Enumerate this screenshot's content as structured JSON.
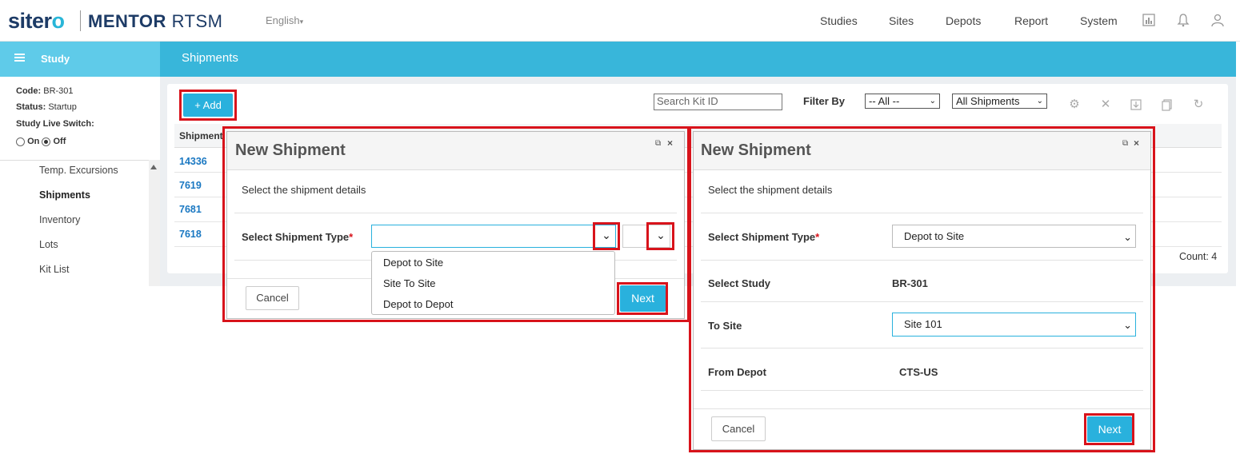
{
  "app": {
    "brand_a": "siter",
    "brand_o": "o",
    "brand_b": "MENTOR",
    "brand_c": "RTSM",
    "language": "English"
  },
  "nav": [
    "Studies",
    "Sites",
    "Depots",
    "Report",
    "System"
  ],
  "bar": {
    "study": "Study",
    "page_title": "Shipments"
  },
  "study_info": {
    "code_label": "Code:",
    "code": "BR-301",
    "status_label": "Status:",
    "status": "Startup",
    "live_label": "Study Live Switch:",
    "on": "On",
    "off": "Off"
  },
  "sidebar": {
    "items": [
      "Temp. Excursions",
      "Shipments",
      "Inventory",
      "Lots",
      "Kit List"
    ]
  },
  "toolbar": {
    "add": "+ Add",
    "search_placeholder": "Search Kit ID",
    "filter_by": "Filter By",
    "filter_all": "-- All --",
    "filter_ship": "All Shipments"
  },
  "table": {
    "header": "Shipment",
    "ids": [
      "14336",
      "7619",
      "7681",
      "7618"
    ],
    "count": "Count: 4"
  },
  "dialog1": {
    "title": "New Shipment",
    "subtitle": "Select the shipment details",
    "type_label": "Select Shipment Type",
    "required": "*",
    "options": [
      "Depot to Site",
      "Site To Site",
      "Depot to Depot"
    ],
    "cancel": "Cancel",
    "next": "Next"
  },
  "dialog2": {
    "title": "New Shipment",
    "subtitle": "Select the shipment details",
    "type_label": "Select Shipment Type",
    "required": "*",
    "type_value": "Depot to Site",
    "study_label": "Select Study",
    "study_value": "BR-301",
    "to_site_label": "To Site",
    "to_site_value": "Site 101",
    "from_depot_label": "From Depot",
    "from_depot_value": "CTS-US",
    "cancel": "Cancel",
    "next": "Next"
  },
  "colors": {
    "accent": "#38b6da",
    "highlight": "#d8131b",
    "link": "#1a78c2"
  }
}
